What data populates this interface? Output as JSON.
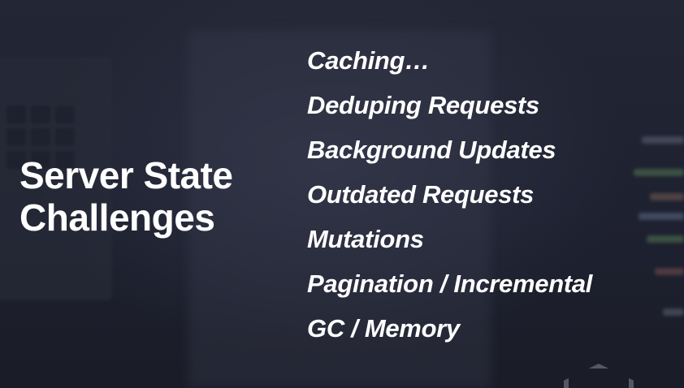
{
  "slide": {
    "title_line1": "Server State",
    "title_line2": "Challenges",
    "items": [
      "Caching…",
      "Deduping Requests",
      "Background Updates",
      "Outdated Requests",
      "Mutations",
      "Pagination / Incremental",
      "GC / Memory"
    ]
  },
  "colors": {
    "background": "#1d1f2b",
    "text": "#ffffff"
  }
}
